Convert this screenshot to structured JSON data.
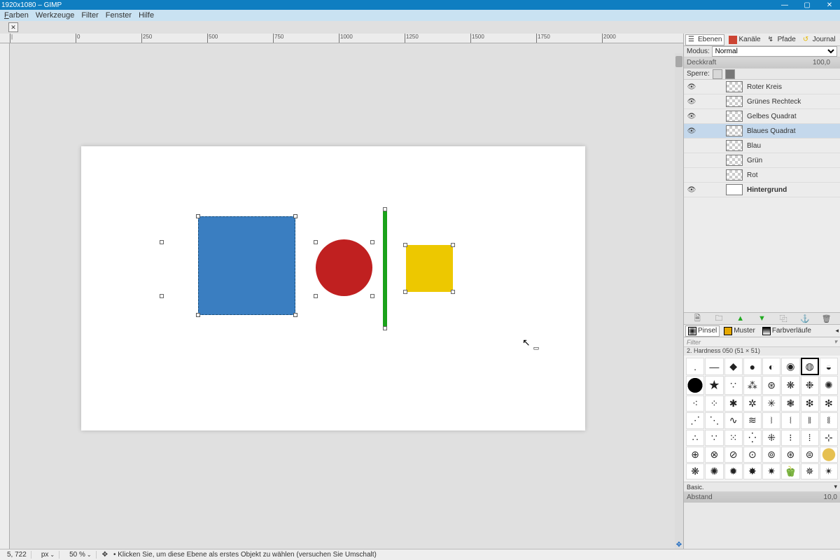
{
  "title": "1920x1080 – GIMP",
  "menu": [
    "Farben",
    "Werkzeuge",
    "Filter",
    "Fenster",
    "Hilfe"
  ],
  "ruler_ticks": [
    0,
    250,
    500,
    750,
    1000,
    1250,
    1500,
    1750,
    2000
  ],
  "dock_tabs": [
    {
      "label": "Ebenen",
      "active": true
    },
    {
      "label": "Kanäle",
      "active": false
    },
    {
      "label": "Pfade",
      "active": false
    },
    {
      "label": "Journal",
      "active": false
    }
  ],
  "mode": {
    "label": "Modus:",
    "value": "Normal"
  },
  "opacity": {
    "label": "Deckkraft",
    "value": "100,0"
  },
  "lock_label": "Sperre:",
  "layers": [
    {
      "name": "Roter Kreis",
      "visible": true,
      "active": false,
      "indent": 1
    },
    {
      "name": "Grünes Rechteck",
      "visible": true,
      "active": false,
      "indent": 1
    },
    {
      "name": "Gelbes Quadrat",
      "visible": true,
      "active": false,
      "indent": 1
    },
    {
      "name": "Blaues Quadrat",
      "visible": true,
      "active": true,
      "indent": 1
    },
    {
      "name": "Blau",
      "visible": false,
      "active": false,
      "indent": 1
    },
    {
      "name": "Grün",
      "visible": false,
      "active": false,
      "indent": 1
    },
    {
      "name": "Rot",
      "visible": false,
      "active": false,
      "indent": 1
    },
    {
      "name": "Hintergrund",
      "visible": true,
      "active": false,
      "indent": 1,
      "bold": true,
      "white": true
    }
  ],
  "brush_tabs": [
    {
      "label": "Pinsel",
      "active": true
    },
    {
      "label": "Muster",
      "active": false
    },
    {
      "label": "Farbverläufe",
      "active": false
    }
  ],
  "filter_placeholder": "Filter",
  "brush_info": "2. Hardness 050 (51 × 51)",
  "brush_preset": "Basic.",
  "spacing": {
    "label": "Abstand",
    "value": "10,0"
  },
  "status": {
    "pos": "5, 722",
    "unit": "px",
    "zoom": "50 %",
    "hint": "Klicken Sie, um diese Ebene als erstes Objekt zu wählen (versuchen Sie Umschalt)"
  }
}
